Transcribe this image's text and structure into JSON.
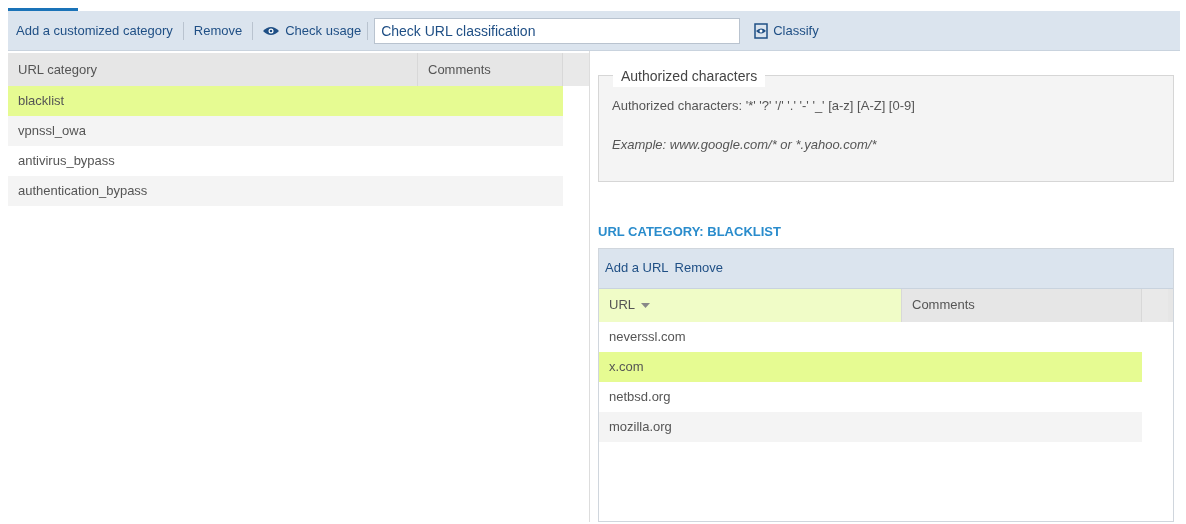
{
  "toolbar": {
    "buttons": [
      {
        "kind": "link",
        "label": "Add a customized category"
      },
      {
        "kind": "link",
        "label": "Remove"
      },
      {
        "kind": "eye",
        "label": "Check usage"
      }
    ],
    "search": {
      "value": "Check URL classification"
    },
    "classify": "Classify"
  },
  "categories": {
    "columns": [
      {
        "label": "URL category",
        "sorted": false
      },
      {
        "label": "Comments",
        "sorted": false
      }
    ],
    "rows": [
      {
        "name": "blacklist",
        "selected": true
      },
      {
        "name": "vpnssl_owa",
        "selected": false
      },
      {
        "name": "antivirus_bypass",
        "selected": false
      },
      {
        "name": "authentication_bypass",
        "selected": false
      }
    ]
  },
  "help": {
    "legend": "Authorized characters",
    "text": "Authorized characters: '*' '?' '/' '.' '-' '_' [a-z] [A-Z] [0-9]",
    "example": "Example: www.google.com/* or *.yahoo.com/*"
  },
  "detail": {
    "title": "URL CATEGORY: BLACKLIST",
    "actions": [
      "Add a URL",
      "Remove"
    ],
    "columns": [
      {
        "label": "URL",
        "sorted": true
      },
      {
        "label": "Comments",
        "sorted": false
      }
    ],
    "rows": [
      {
        "url": "neverssl.com",
        "selected": false
      },
      {
        "url": "x.com",
        "selected": true
      },
      {
        "url": "netbsd.org",
        "selected": false
      },
      {
        "url": "mozilla.org",
        "selected": false
      }
    ]
  }
}
